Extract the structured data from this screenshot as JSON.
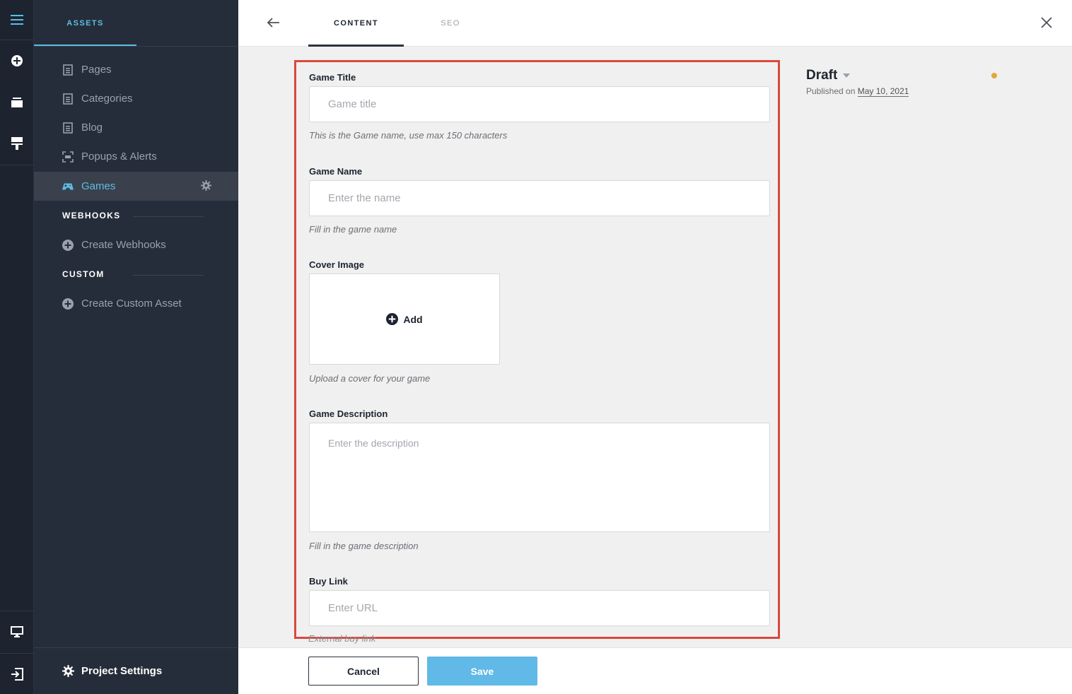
{
  "rail": {
    "icons": [
      "menu-icon",
      "add-circle-icon",
      "layers-icon",
      "brush-icon",
      "monitor-icon",
      "exit-icon"
    ]
  },
  "sidebar": {
    "tab_label": "ASSETS",
    "items": [
      {
        "label": "Pages",
        "icon": "page-icon"
      },
      {
        "label": "Categories",
        "icon": "page-icon"
      },
      {
        "label": "Blog",
        "icon": "page-icon"
      },
      {
        "label": "Popups & Alerts",
        "icon": "popup-icon"
      },
      {
        "label": "Games",
        "icon": "gamepad-icon",
        "active": true
      }
    ],
    "webhooks": {
      "title": "WEBHOOKS",
      "create_label": "Create Webhooks"
    },
    "custom": {
      "title": "CUSTOM",
      "create_label": "Create Custom Asset"
    },
    "project_settings": "Project Settings"
  },
  "topbar": {
    "tabs": [
      {
        "label": "CONTENT",
        "active": true
      },
      {
        "label": "SEO",
        "active": false
      }
    ]
  },
  "form": {
    "game_title": {
      "label": "Game Title",
      "placeholder": "Game title",
      "hint": "This is the Game name, use max 150 characters"
    },
    "game_name": {
      "label": "Game Name",
      "placeholder": "Enter the name",
      "hint": "Fill in the game name"
    },
    "cover_image": {
      "label": "Cover Image",
      "add_label": "Add",
      "hint": "Upload a cover for your game"
    },
    "game_description": {
      "label": "Game Description",
      "placeholder": "Enter the description",
      "hint": "Fill in the game description"
    },
    "buy_link": {
      "label": "Buy Link",
      "placeholder": "Enter URL",
      "hint": "External buy link"
    }
  },
  "status": {
    "title": "Draft",
    "published_prefix": "Published on",
    "published_date": "May 10, 2021",
    "dot_color": "#e0a83a"
  },
  "footer": {
    "cancel_label": "Cancel",
    "save_label": "Save"
  },
  "colors": {
    "accent": "#5bbde4",
    "highlight_border": "#d9493d",
    "save_button": "#60b9e6"
  }
}
